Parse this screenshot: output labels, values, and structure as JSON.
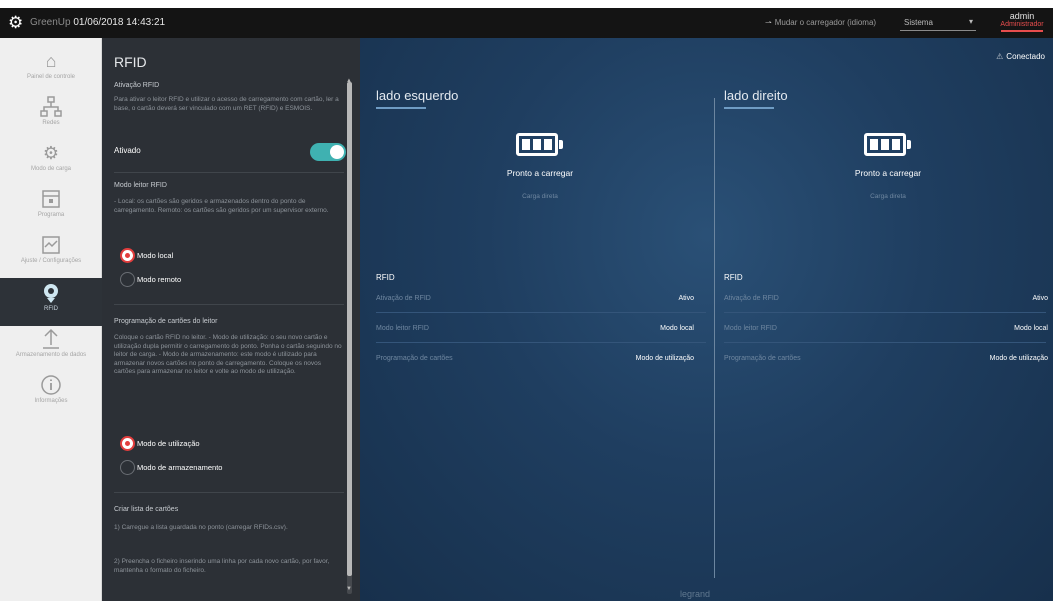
{
  "topbar": {
    "title_prefix": "GreenUp",
    "title_date": "01/06/2018 14:43:21",
    "language_link": "Mudar o carregador (idioma)",
    "select_value": "Sistema",
    "user_name": "admin",
    "user_role": "Administrador"
  },
  "nav": {
    "items": [
      {
        "label": "Painel de controle",
        "icon": "home-icon"
      },
      {
        "label": "Redes",
        "icon": "network-icon"
      },
      {
        "label": "Modo de carga",
        "icon": "gear-icon"
      },
      {
        "label": "Programa",
        "icon": "calendar-icon"
      },
      {
        "label": "Ajuste / Configurações",
        "icon": "chart-icon"
      },
      {
        "label": "RFID",
        "icon": "rfid-icon"
      },
      {
        "label": "Armazenamento de dados",
        "icon": "upload-icon"
      },
      {
        "label": "Informações",
        "icon": "info-icon"
      }
    ],
    "active_index": 5
  },
  "panel": {
    "title": "RFID",
    "activation_heading": "Ativação RFID",
    "activation_text": "Para ativar o leitor RFID e utilizar o acesso de carregamento com cartão, ler a base, o cartão deverá ser vinculado com um RET (RFID) e ESMOIS.",
    "activated_label": "Ativado",
    "reader_heading": "Modo leitor RFID",
    "reader_text": "- Local: os cartões são geridos e armazenados dentro do ponto de carregamento. Remoto: os cartões são geridos por um supervisor externo.",
    "mode_local": "Modo local",
    "mode_remote": "Modo remoto",
    "programming_heading": "Programação de cartões do leitor",
    "programming_text": "Coloque o cartão RFID no leitor. - Modo de utilização: o seu novo cartão e utilização dupla permitir o carregamento do ponto. Ponha o cartão seguindo no leitor de carga. - Modo de armazenamento: este modo é utilizado para armazenar novos cartões no ponto de carregamento. Coloque os novos cartões para armazenar no leitor e volte ao modo de utilização.",
    "mode_use": "Modo de utilização",
    "mode_storage": "Modo de armazenamento",
    "list_heading": "Criar lista de cartões",
    "list_step1": "1) Carregue a lista guardada no ponto (carregar RFIDs.csv).",
    "list_step2": "2) Preencha o ficheiro inserindo uma linha por cada novo cartão, por favor, mantenha o formato do ficheiro."
  },
  "main": {
    "connection": "Conectado",
    "brand": "legrand",
    "sides": [
      {
        "title": "lado esquerdo",
        "status": "Pronto a carregar",
        "mode": "Carga direta",
        "rfid_title": "RFID",
        "rows": [
          {
            "key": "Ativação de RFID",
            "value": "Ativo"
          },
          {
            "key": "Modo leitor RFID",
            "value": "Modo local"
          },
          {
            "key": "Programação de cartões",
            "value": "Modo de utilização"
          }
        ]
      },
      {
        "title": "lado direito",
        "status": "Pronto a carregar",
        "mode": "Carga direta",
        "rfid_title": "RFID",
        "rows": [
          {
            "key": "Ativação de RFID",
            "value": "Ativo"
          },
          {
            "key": "Modo leitor RFID",
            "value": "Modo local"
          },
          {
            "key": "Programação de cartões",
            "value": "Modo de utilização"
          }
        ]
      }
    ]
  },
  "colors": {
    "accent_toggle": "#3fb1b1",
    "radio_selected": "#e23d3d",
    "main_bg": "#1f3e60",
    "panel_bg": "#2c3036"
  }
}
